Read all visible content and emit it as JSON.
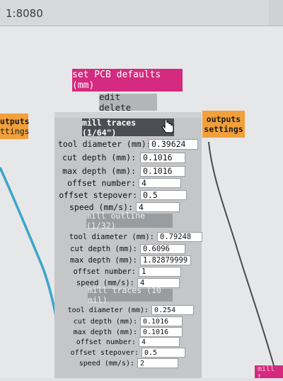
{
  "browser": {
    "url": "1:8080"
  },
  "toolbar": {
    "defaults_label": "set PCB defaults (mm)",
    "edit_delete_label": "edit delete"
  },
  "side_buttons": {
    "left": {
      "line1": "utputs",
      "line2": "ttings"
    },
    "right": {
      "line1": "outputs",
      "line2": "settings"
    }
  },
  "sections": [
    {
      "header": "mill traces (1/64\")",
      "fields": [
        {
          "label": "tool diameter (mm):",
          "value": "0.39624"
        },
        {
          "label": "cut depth (mm):",
          "value": "0.1016"
        },
        {
          "label": "max depth (mm):",
          "value": "0.1016"
        },
        {
          "label": "offset number:",
          "value": "4"
        },
        {
          "label": "offset stepover:",
          "value": "0.5"
        },
        {
          "label": "speed (mm/s):",
          "value": "4"
        }
      ]
    },
    {
      "header": "mill outline (1/32)",
      "fields": [
        {
          "label": "tool diameter (mm):",
          "value": "0.79248"
        },
        {
          "label": "cut depth (mm):",
          "value": "0.6096"
        },
        {
          "label": "max depth (mm):",
          "value": "1.82879999"
        },
        {
          "label": "offset number:",
          "value": "1"
        },
        {
          "label": "speed (mm/s):",
          "value": "4"
        }
      ]
    },
    {
      "header": "mill traces (10 mil)",
      "fields": [
        {
          "label": "tool diameter (mm):",
          "value": "0.254"
        },
        {
          "label": "cut depth (mm):",
          "value": "0.1016"
        },
        {
          "label": "max depth (mm):",
          "value": "0.1016"
        },
        {
          "label": "offset number:",
          "value": "4"
        },
        {
          "label": "offset stepover:",
          "value": "0.5"
        },
        {
          "label": "speed (mm/s):",
          "value": "2"
        }
      ]
    }
  ],
  "corner_button": {
    "label": "mill t"
  },
  "colors": {
    "accent_pink": "#d42a7f",
    "accent_orange": "#f1a03b",
    "wire_blue": "#3aa6c9",
    "panel_gray": "#c4c6c8"
  },
  "icons": {
    "cursor": "hand-pointer-icon"
  }
}
